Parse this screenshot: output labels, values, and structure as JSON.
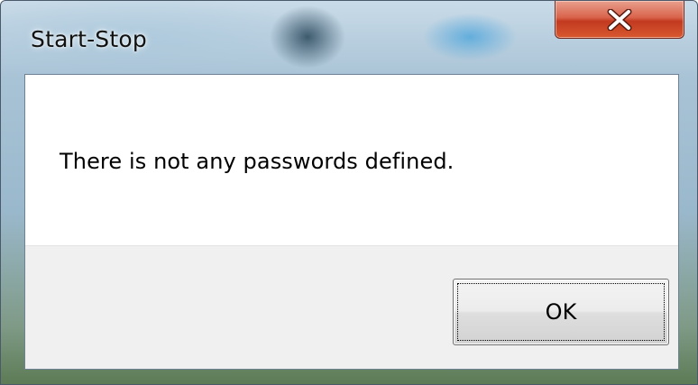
{
  "window": {
    "title": "Start-Stop"
  },
  "title_bar": {
    "close_icon": "close-icon"
  },
  "dialog": {
    "message": "There is not any passwords defined.",
    "ok_label": "OK"
  },
  "colors": {
    "close_button": "#c23a20",
    "client_background": "#ffffff",
    "button_area_background": "#f0f0f0"
  }
}
